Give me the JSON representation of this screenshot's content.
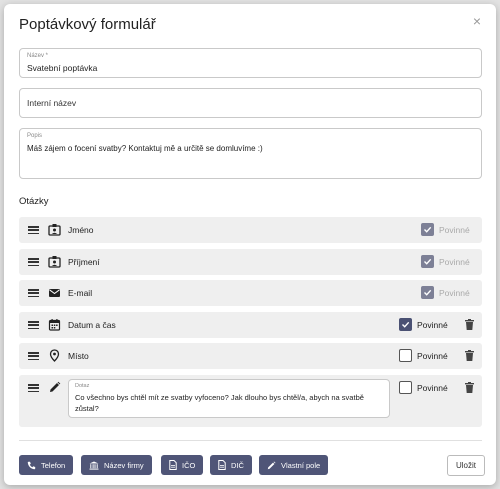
{
  "dialog": {
    "title": "Poptávkový formulář",
    "close_icon": "×"
  },
  "fields": {
    "name": {
      "label": "Název *",
      "value": "Svatební poptávka"
    },
    "internal_name": {
      "placeholder": "Interní název"
    },
    "description": {
      "label": "Popis",
      "value": "Máš zájem o focení svatby? Kontaktuj mě a určitě se domluvíme :)"
    }
  },
  "questions": {
    "title": "Otázky",
    "items": [
      {
        "label": "Jméno",
        "icon": "id-card-icon",
        "required_label": "Povinné",
        "required": true,
        "locked": true
      },
      {
        "label": "Příjmení",
        "icon": "id-card-icon",
        "required_label": "Povinné",
        "required": true,
        "locked": true
      },
      {
        "label": "E-mail",
        "icon": "envelope-icon",
        "required_label": "Povinné",
        "required": true,
        "locked": true
      },
      {
        "label": "Datum a čas",
        "icon": "calendar-icon",
        "required_label": "Povinné",
        "required": true,
        "locked": false
      },
      {
        "label": "Místo",
        "icon": "location-pin-icon",
        "required_label": "Povinné",
        "required": false,
        "locked": false
      },
      {
        "icon": "pencil-icon",
        "required_label": "Povinné",
        "required": false,
        "locked": false,
        "field_label": "Dotaz",
        "field_value": "Co všechno bys chtěl mít ze svatby vyfoceno? Jak dlouho bys chtěl/a, abych na svatbě zůstal?"
      }
    ]
  },
  "toolbar": {
    "buttons": [
      {
        "label": "Telefon",
        "icon": "phone-icon"
      },
      {
        "label": "Název firmy",
        "icon": "bank-icon"
      },
      {
        "label": "IČO",
        "icon": "document-icon"
      },
      {
        "label": "DIČ",
        "icon": "document-icon"
      },
      {
        "label": "Vlastní pole",
        "icon": "pencil-icon"
      }
    ],
    "save_label": "Uložit"
  },
  "colors": {
    "accent": "#4f5577",
    "checkbox_checked": "#4a5173",
    "checkbox_locked": "#7d8096",
    "row_background": "#efefef"
  }
}
